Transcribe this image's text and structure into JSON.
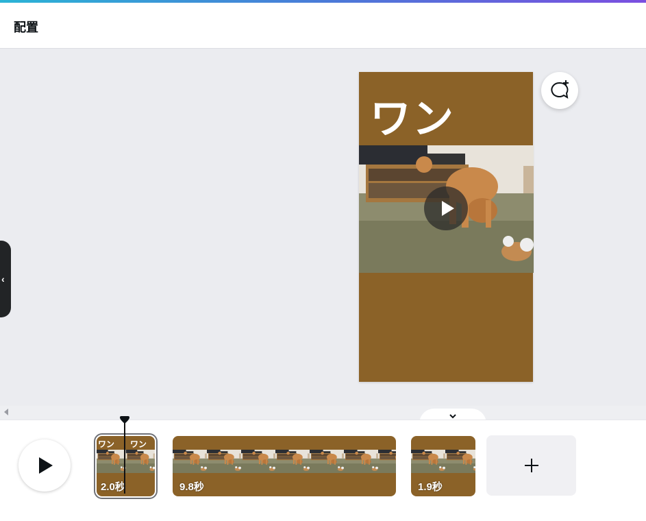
{
  "header": {
    "title": "配置"
  },
  "page": {
    "heading": "ワン",
    "background_color": "#8b6228",
    "video_play_icon": "play-icon"
  },
  "canvas": {
    "comment_button_icon": "comment-add-icon",
    "side_panel_toggle_icon": "chevron-left-icon"
  },
  "timeline": {
    "play_button_icon": "play-icon",
    "collapse_icon": "chevron-down-icon",
    "clips": [
      {
        "duration": "2.0秒",
        "thumb_text": [
          "ワン",
          "ワン"
        ],
        "selected": true
      },
      {
        "duration": "9.8秒",
        "selected": false
      },
      {
        "duration": "1.9秒",
        "selected": false
      }
    ],
    "add_clip_icon": "plus-icon"
  },
  "colors": {
    "accent_gradient_start": "#2bb4d6",
    "accent_gradient_end": "#7b4fe0",
    "canvas_background": "#ebecf0",
    "clip_background": "#8b6228"
  }
}
